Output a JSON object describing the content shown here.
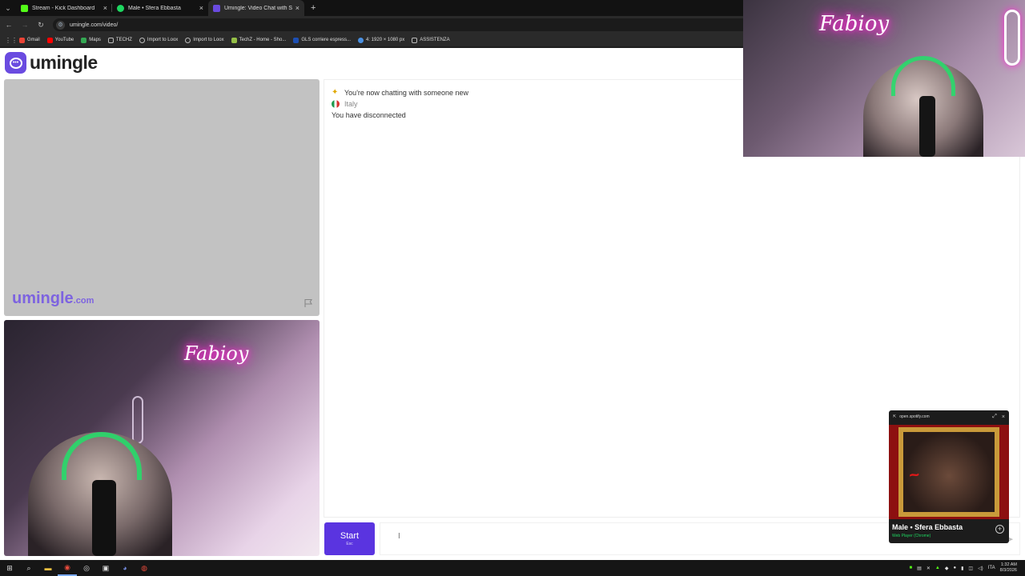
{
  "browser": {
    "tabs": [
      {
        "label": "Stream - Kick Dashboard",
        "icon": "kick-icon",
        "color": "#53fc18",
        "active": false
      },
      {
        "label": "Male • Sfera Ebbasta",
        "icon": "spotify-icon",
        "color": "#1ed760",
        "active": false
      },
      {
        "label": "Umingle: Video Chat with S",
        "icon": "umingle-icon",
        "color": "#6a4be0",
        "active": true
      }
    ],
    "new_tab": "+",
    "url": "umingle.com/video/",
    "bookmarks": [
      "Gmail",
      "YouTube",
      "Maps",
      "TECHZ",
      "Import to Loox",
      "Import to Loox",
      "TechZ - Home - Sho...",
      "GLS corriere espress...",
      "4: 1920 × 1080 px",
      "ASSISTENZA"
    ]
  },
  "site": {
    "logo_text": "umingle",
    "brand_color": "#6a4be0"
  },
  "stranger_video": {
    "watermark": "umingle",
    "watermark_suffix": ".com"
  },
  "self_video": {
    "neon_text": "Fabioy"
  },
  "chat": {
    "messages": [
      {
        "text": "You're now chatting with someone new",
        "icon": "sparkle-icon"
      },
      {
        "text": "Italy",
        "icon": "italy-flag-icon"
      },
      {
        "text": "You have disconnected",
        "icon": ""
      }
    ]
  },
  "controls": {
    "start_label": "Start",
    "start_hint": "Esc"
  },
  "spotify_pip": {
    "url": "open.spotify.com",
    "title": "Male • Sfera Ebbasta",
    "subtitle": "Web Player (Chrome)"
  },
  "taskbar": {
    "time": "1:32 AM",
    "date": "8/3/2026",
    "lang": "ITA"
  }
}
